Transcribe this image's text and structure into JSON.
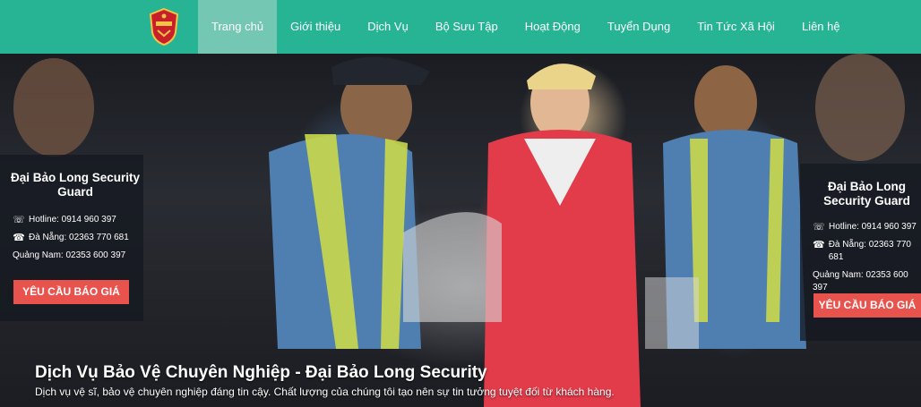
{
  "nav": {
    "logo_icon": "shield-crest-icon",
    "active_color": "#73c7b3",
    "bar_color": "#27b495",
    "items": [
      {
        "label": "Trang chủ"
      },
      {
        "label": "Giới thiệu"
      },
      {
        "label": "Dịch Vụ"
      },
      {
        "label": "Bộ Sưu Tập"
      },
      {
        "label": "Hoạt Động"
      },
      {
        "label": "Tuyển Dụng"
      },
      {
        "label": "Tin Tức Xã Hội"
      },
      {
        "label": "Liên hệ"
      }
    ]
  },
  "left_panel": {
    "title": "Đại Bảo Long Security Guard",
    "hotline": "Hotline: 0914 960 397",
    "danang": "Đà Nẵng: 02363 770 681",
    "quangnam": "Quảng Nam: 02353 600 397",
    "cta": "YÊU CẦU BÁO GIÁ"
  },
  "right_panel": {
    "title": "Đại Bảo Long Security Guard",
    "hotline": "Hotline: 0914 960 397",
    "danang": "Đà Nẵng: 02363 770 681",
    "quangnam": "Quảng Nam: 02353 600 397",
    "cta": "YÊU CẦU BÁO GIÁ"
  },
  "hero": {
    "title": "Dịch Vụ Bảo Vệ Chuyên Nghiệp - Đại Bảo Long Security",
    "subtitle": "Dịch vụ vệ sĩ, bảo vệ chuyên nghiệp đáng tin cậy. Chất lượng của chúng tôi tạo nên sự tin tưởng tuyệt đối từ khách hàng."
  },
  "colors": {
    "cta": "#e8534d"
  }
}
